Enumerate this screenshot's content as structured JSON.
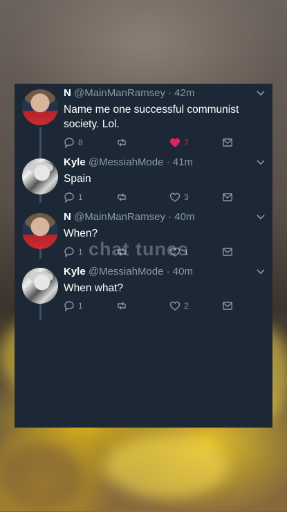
{
  "tweets": [
    {
      "name": "N",
      "handle": "@MainManRamsey",
      "time": "· 42m",
      "text": "Name me one successful communist society. Lol.",
      "replies": "8",
      "retweets": "",
      "likes": "7",
      "liked": true,
      "avatar": "red"
    },
    {
      "name": "Kyle",
      "handle": "@MessiahMode",
      "time": "· 41m",
      "text": "Spain",
      "replies": "1",
      "retweets": "",
      "likes": "3",
      "liked": false,
      "avatar": "bw"
    },
    {
      "name": "N",
      "handle": "@MainManRamsey",
      "time": "· 40m",
      "text": "When?",
      "replies": "1",
      "retweets": "",
      "likes": "1",
      "liked": false,
      "avatar": "red"
    },
    {
      "name": "Kyle",
      "handle": "@MessiahMode",
      "time": "· 40m",
      "text": "When what?",
      "replies": "1",
      "retweets": "",
      "likes": "2",
      "liked": false,
      "avatar": "bw"
    }
  ],
  "watermark": "chat tunes",
  "colors": {
    "card_bg": "#1c2835",
    "secondary_text": "#8899a6",
    "like_active": "#e0245e",
    "thread_line": "#3d5066"
  },
  "icons": [
    "reply-icon",
    "retweet-icon",
    "like-icon",
    "dm-icon",
    "chevron-down-icon"
  ]
}
